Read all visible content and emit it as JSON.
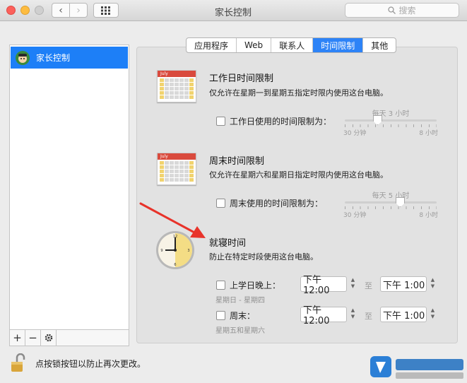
{
  "window": {
    "title": "家长控制"
  },
  "search": {
    "placeholder": "搜索"
  },
  "sidebar": {
    "items": [
      {
        "label": "家长控制"
      }
    ]
  },
  "tabs": [
    {
      "label": "应用程序"
    },
    {
      "label": "Web"
    },
    {
      "label": "联系人"
    },
    {
      "label": "时间限制",
      "active": true
    },
    {
      "label": "其他"
    }
  ],
  "weekday": {
    "title": "工作日时间限制",
    "desc": "仅允许在星期一到星期五指定时限内使用这台电脑。",
    "checkbox_label": "工作日使用的时间限制为：",
    "slider_value": "每天 3 小时",
    "slider_min": "30 分钟",
    "slider_max": "8 小时",
    "calendar_month": "July"
  },
  "weekend": {
    "title": "周末时间限制",
    "desc": "仅允许在星期六和星期日指定时限内使用这台电脑。",
    "checkbox_label": "周末使用的时间限制为：",
    "slider_value": "每天 5 小时",
    "slider_min": "30 分钟",
    "slider_max": "8 小时",
    "calendar_month": "July"
  },
  "bedtime": {
    "title": "就寝时间",
    "desc": "防止在特定时段使用这台电脑。",
    "school_label": "上学日晚上：",
    "school_sub": "星期日 - 星期四",
    "school_from": "下午12:00",
    "school_to": "下午  1:00",
    "weekend_label": "周末：",
    "weekend_sub": "星期五和星期六",
    "weekend_from": "下午12:00",
    "weekend_to": "下午  1:00",
    "to_label": "至"
  },
  "footer": {
    "lock_text": "点按锁按钮以防止再次更改。"
  },
  "colors": {
    "accent": "#2d83f7",
    "calendar_red": "#d94a3d",
    "arrow_red": "#e8332a"
  }
}
